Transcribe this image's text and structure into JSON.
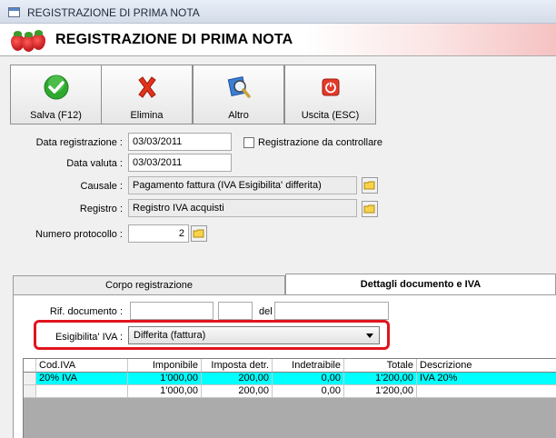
{
  "window": {
    "title": "REGISTRAZIONE DI PRIMA NOTA"
  },
  "header": {
    "title": "REGISTRAZIONE DI PRIMA NOTA",
    "logo_icon": "strawberries-icon"
  },
  "toolbar": {
    "buttons": [
      {
        "label": "Salva (F12)",
        "icon": "green-check-icon"
      },
      {
        "label": "Elimina",
        "icon": "red-x-icon"
      },
      {
        "label": "Altro",
        "icon": "magnifier-icon"
      },
      {
        "label": "Uscita (ESC)",
        "icon": "power-icon"
      }
    ]
  },
  "form": {
    "data_registrazione": {
      "label": "Data registrazione :",
      "value": "03/03/2011"
    },
    "data_valuta": {
      "label": "Data valuta :",
      "value": "03/03/2011"
    },
    "causale": {
      "label": "Causale :",
      "value": "Pagamento fattura (IVA Esigibilita' differita)"
    },
    "registro": {
      "label": "Registro :",
      "value": "Registro IVA acquisti"
    },
    "numero_protocollo": {
      "label": "Numero protocollo :",
      "value": "2"
    },
    "da_controllare": {
      "label": "Registrazione da controllare",
      "checked": false
    }
  },
  "tabs": [
    {
      "label": "Corpo registrazione",
      "active": false
    },
    {
      "label": "Dettagli documento e IVA",
      "active": true
    }
  ],
  "details": {
    "rif_documento": {
      "label": "Rif. documento :",
      "value1": "",
      "value2": ""
    },
    "del": {
      "label": "del",
      "value": ""
    },
    "esigibilita": {
      "label": "Esigibilita' IVA :",
      "value": "Differita (fattura)"
    }
  },
  "grid": {
    "columns": [
      "Cod.IVA",
      "Imponibile",
      "Imposta detr.",
      "Indetraibile",
      "Totale",
      "Descrizione"
    ],
    "rows": [
      {
        "cod_iva": "20% IVA",
        "imponibile": "1'000,00",
        "imposta_detr": "200,00",
        "indetraibile": "0,00",
        "totale": "1'200,00",
        "descrizione": "IVA 20%",
        "selected": true
      },
      {
        "cod_iva": "",
        "imponibile": "1'000,00",
        "imposta_detr": "200,00",
        "indetraibile": "0,00",
        "totale": "1'200,00",
        "descrizione": "",
        "selected": false
      }
    ]
  },
  "colors": {
    "highlight": "#e0141e",
    "selected_row": "#00ffff",
    "accent": "#c0181e"
  }
}
